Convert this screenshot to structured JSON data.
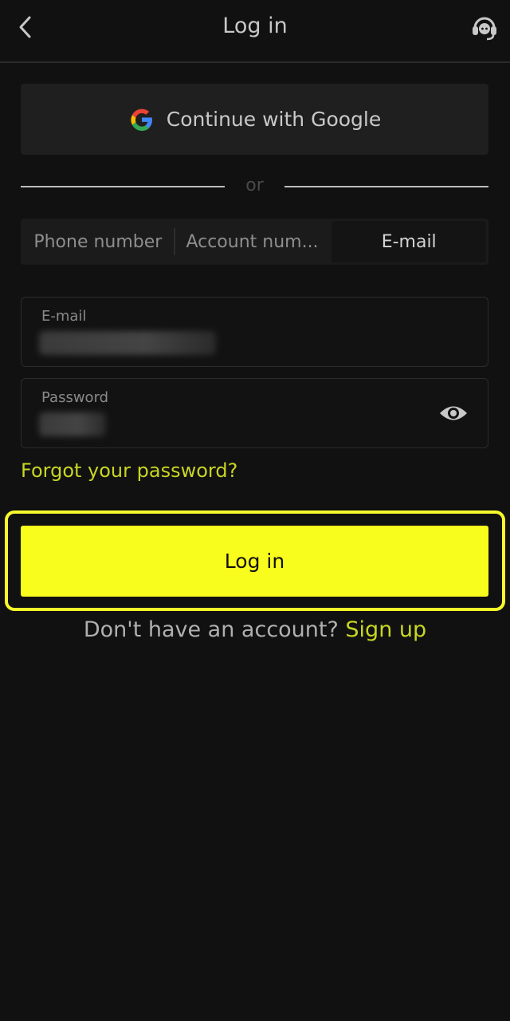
{
  "header": {
    "title": "Log in",
    "back_icon": "chevron-left-icon",
    "support_icon": "headset-support-icon"
  },
  "google": {
    "label": "Continue with Google",
    "icon": "google-g-icon"
  },
  "divider": {
    "text": "or"
  },
  "tabs": [
    {
      "label": "Phone number",
      "active": false
    },
    {
      "label": "Account num...",
      "active": false
    },
    {
      "label": "E-mail",
      "active": true
    }
  ],
  "email_field": {
    "label": "E-mail"
  },
  "password_field": {
    "label": "Password",
    "toggle_icon": "eye-icon"
  },
  "forgot": {
    "label": "Forgot your password?"
  },
  "login_button": {
    "label": "Log in"
  },
  "signup": {
    "prompt": "Don't have an account?",
    "link": "Sign up"
  },
  "colors": {
    "accent": "#f9fd1d",
    "link": "#c8d622",
    "background": "#111111"
  }
}
